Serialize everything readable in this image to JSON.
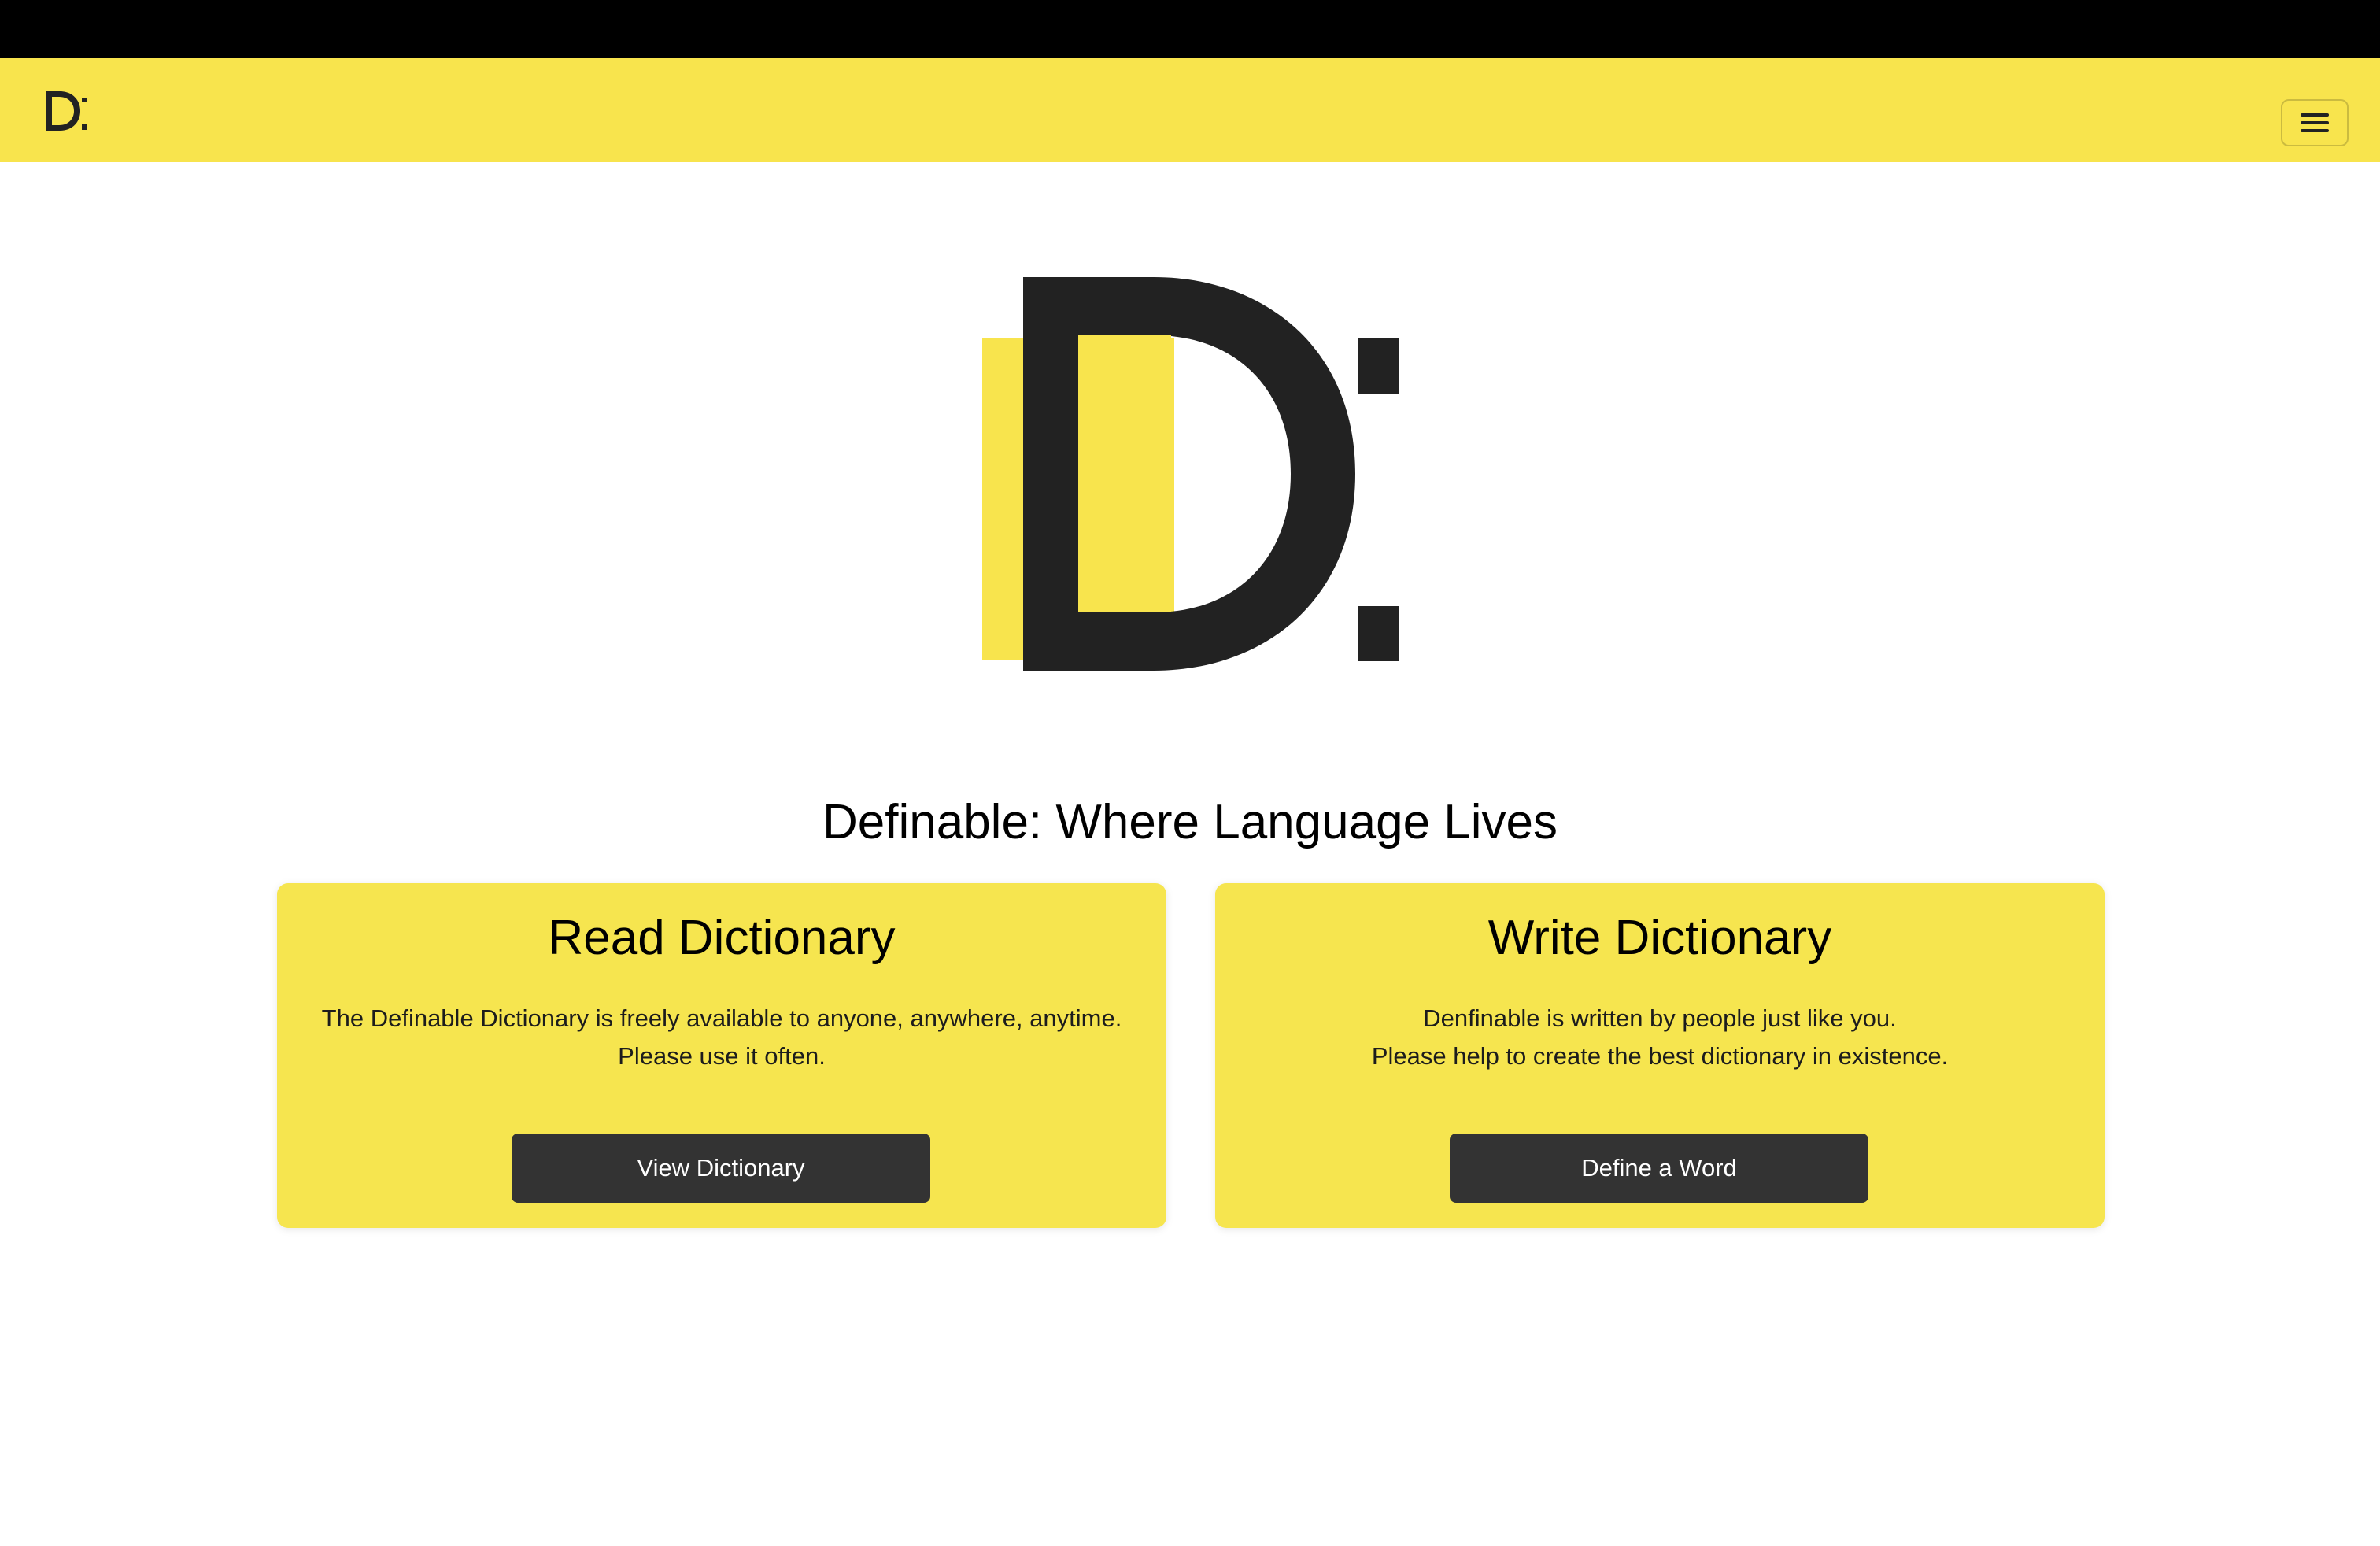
{
  "brand": {
    "logo_icon": "definable-d-logo",
    "primary_color": "#f8e44d",
    "dark_color": "#222222"
  },
  "navbar": {
    "toggle_icon": "hamburger-icon",
    "toggle_label": "Toggle navigation"
  },
  "hero": {
    "tagline": "Definable: Where Language Lives"
  },
  "cards": {
    "read": {
      "title": "Read Dictionary",
      "text_line1": "The Definable Dictionary is freely available to anyone, anywhere, anytime.",
      "text_line2": "Please use it often.",
      "button_label": "View Dictionary"
    },
    "write": {
      "title": "Write Dictionary",
      "text_line1": "Denfinable is written by people just like you.",
      "text_line2": "Please help to create the best dictionary in existence.",
      "button_label": "Define a Word"
    }
  }
}
